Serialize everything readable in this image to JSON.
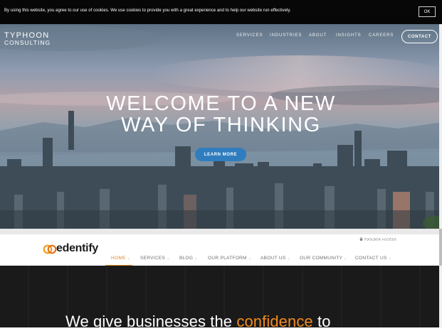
{
  "cookie_bar": {
    "text": "By using this website, you agree to our use of cookies. We use cookies to provide you with a great experience and to help our website run effectively.",
    "ok_label": "OK"
  },
  "typhoon": {
    "logo_line1": "TYPHOON",
    "logo_line2": "CONSULTING",
    "nav": [
      "SERVICES",
      "INDUSTRIES",
      "ABOUT",
      "INSIGHTS",
      "CAREERS"
    ],
    "contact_label": "CONTACT",
    "headline_line1": "WELCOME TO A NEW",
    "headline_line2": "WAY OF THINKING",
    "cta_label": "LEARN MORE"
  },
  "edentify": {
    "logo_text": "edentify",
    "toolbox_label": "TOOLBOX ACCESS",
    "nav": [
      {
        "label": "HOME",
        "active": true
      },
      {
        "label": "SERVICES",
        "active": false
      },
      {
        "label": "BLOG",
        "active": false
      },
      {
        "label": "OUR PLATFORM",
        "active": false
      },
      {
        "label": "ABOUT US",
        "active": false
      },
      {
        "label": "OUR COMMUNITY",
        "active": false
      },
      {
        "label": "CONTACT US",
        "active": false
      }
    ],
    "tagline_before": "We give businesses the ",
    "tagline_accent": "confidence",
    "tagline_after": " to",
    "accent_color": "#f28a1e",
    "brand_color": "#e58a1f"
  },
  "icons": {
    "logo_mark": "edentify-rings-icon",
    "lock": "lock-icon",
    "dropdown": "chevron-down-icon"
  }
}
